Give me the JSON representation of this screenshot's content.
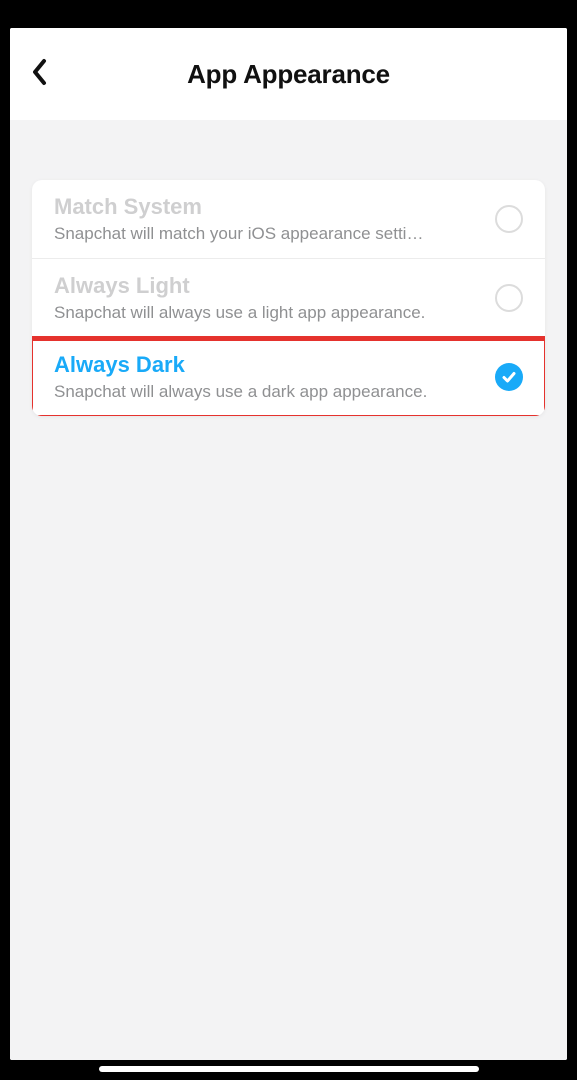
{
  "header": {
    "title": "App Appearance"
  },
  "options": [
    {
      "title": "Match System",
      "subtitle": "Snapchat will match your iOS appearance setti…",
      "selected": false,
      "highlighted": false,
      "name": "appearance-option-match-system"
    },
    {
      "title": "Always Light",
      "subtitle": "Snapchat will always use a light app appearance.",
      "selected": false,
      "highlighted": false,
      "name": "appearance-option-always-light"
    },
    {
      "title": "Always Dark",
      "subtitle": "Snapchat will always use a dark app appearance.",
      "selected": true,
      "highlighted": true,
      "name": "appearance-option-always-dark"
    }
  ],
  "annotation": {
    "highlight_color": "#e5322d"
  }
}
